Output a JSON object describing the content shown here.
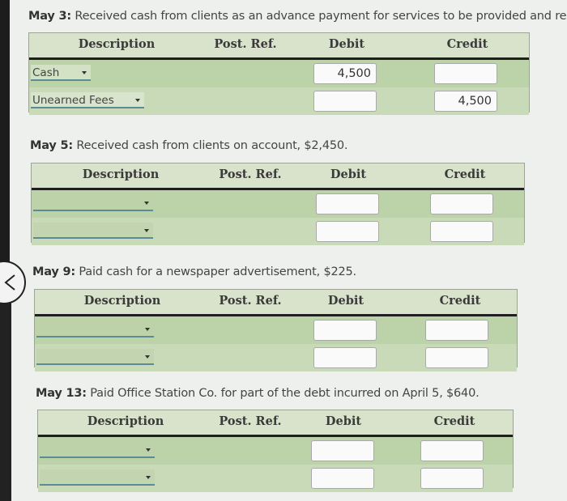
{
  "nav": {
    "back_label": "Back"
  },
  "columns": {
    "description": "Description",
    "post_ref": "Post. Ref.",
    "debit": "Debit",
    "credit": "Credit"
  },
  "entries": [
    {
      "date": "May 3:",
      "text": "Received cash from clients as an advance payment for services to be provided and recor",
      "rows": [
        {
          "account": "Cash",
          "post_ref": "",
          "debit": "4,500",
          "credit": ""
        },
        {
          "account": "Unearned Fees",
          "post_ref": "",
          "debit": "",
          "credit": "4,500"
        }
      ]
    },
    {
      "date": "May 5:",
      "text": "Received cash from clients on account, $2,450.",
      "rows": [
        {
          "account": "",
          "post_ref": "",
          "debit": "",
          "credit": ""
        },
        {
          "account": "",
          "post_ref": "",
          "debit": "",
          "credit": ""
        }
      ]
    },
    {
      "date": "May 9:",
      "text": "Paid cash for a newspaper advertisement, $225.",
      "rows": [
        {
          "account": "",
          "post_ref": "",
          "debit": "",
          "credit": ""
        },
        {
          "account": "",
          "post_ref": "",
          "debit": "",
          "credit": ""
        }
      ]
    },
    {
      "date": "May 13:",
      "text": "Paid Office Station Co. for part of the debt incurred on April 5, $640.",
      "rows": [
        {
          "account": "",
          "post_ref": "",
          "debit": "",
          "credit": ""
        },
        {
          "account": "",
          "post_ref": "",
          "debit": "",
          "credit": ""
        }
      ]
    }
  ]
}
